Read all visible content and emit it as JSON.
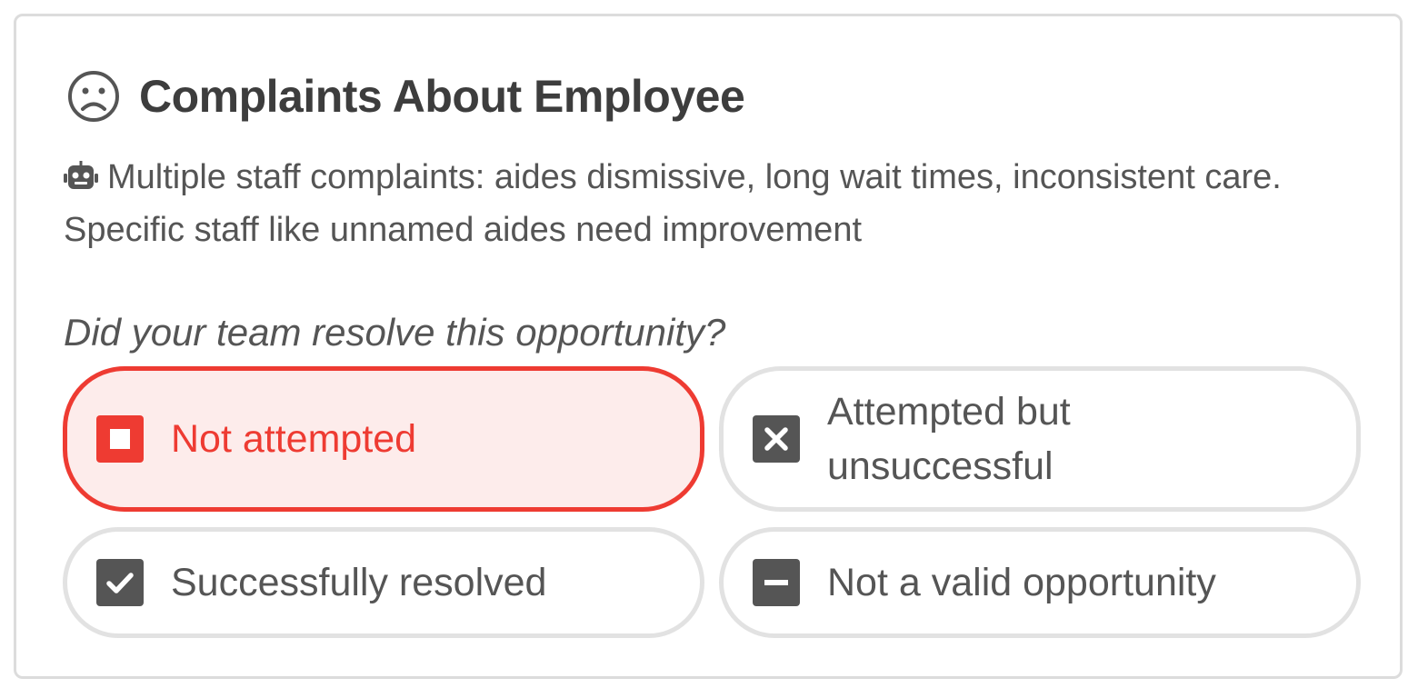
{
  "card": {
    "title": "Complaints About Employee",
    "title_icon": "frown-icon",
    "summary_icon": "robot-icon",
    "summary": "Multiple staff complaints: aides dismissive, long wait times, inconsistent care. Specific staff like unnamed aides need improvement",
    "question": "Did your team resolve this opportunity?"
  },
  "options": [
    {
      "label": "Not attempted",
      "icon": "stop-square-icon",
      "selected": true
    },
    {
      "label": "Attempted but unsuccessful",
      "icon": "x-square-icon",
      "selected": false
    },
    {
      "label": "Successfully resolved",
      "icon": "check-square-icon",
      "selected": false
    },
    {
      "label": "Not a valid opportunity",
      "icon": "minus-square-icon",
      "selected": false
    }
  ],
  "colors": {
    "accent_selected": "#ee3b32",
    "selected_bg": "#fdeceb",
    "text": "#555555",
    "title": "#3d3d3d",
    "border": "#e2e2e2"
  }
}
